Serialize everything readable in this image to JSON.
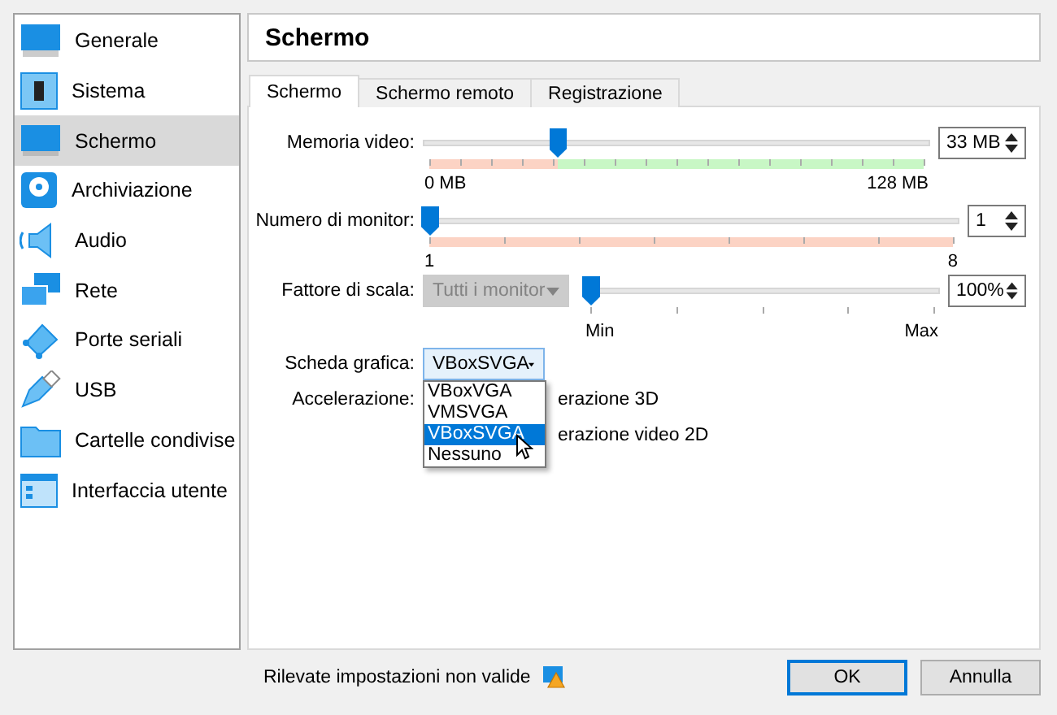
{
  "sidebar": {
    "items": [
      {
        "label": "Generale",
        "selected": false
      },
      {
        "label": "Sistema",
        "selected": false
      },
      {
        "label": "Schermo",
        "selected": true
      },
      {
        "label": "Archiviazione",
        "selected": false
      },
      {
        "label": "Audio",
        "selected": false
      },
      {
        "label": "Rete",
        "selected": false
      },
      {
        "label": "Porte seriali",
        "selected": false
      },
      {
        "label": "USB",
        "selected": false
      },
      {
        "label": "Cartelle condivise",
        "selected": false
      },
      {
        "label": "Interfaccia utente",
        "selected": false
      }
    ]
  },
  "page_title": "Schermo",
  "tabs": [
    {
      "label": "Schermo",
      "selected": true
    },
    {
      "label": "Schermo remoto",
      "selected": false
    },
    {
      "label": "Registrazione",
      "selected": false
    }
  ],
  "memory": {
    "label": "Memoria video:",
    "level": 0.26,
    "value": "33 MB",
    "warn_zone": true,
    "ok_zone": true,
    "min_label": "0 MB",
    "max_label": "128 MB"
  },
  "monitors": {
    "label": "Numero di monitor:",
    "level": 0,
    "value": "1",
    "warn_zone": true,
    "ok_zone": false,
    "min_label": "1",
    "max_label": "8"
  },
  "scale_factor": {
    "label": "Fattore di scala:",
    "combo": {
      "value": "Tutti i monitor",
      "disabled": true
    },
    "level": 0,
    "value": "100%",
    "warn_zone": false,
    "ok_zone": false,
    "min_label": "Min",
    "max_label": "Max"
  },
  "graphics": {
    "label": "Scheda grafica:",
    "value": "VBoxSVGA",
    "expanded": true,
    "options": [
      {
        "label": "VBoxVGA",
        "selected": false
      },
      {
        "label": "VMSVGA",
        "selected": false
      },
      {
        "label": "VBoxSVGA",
        "selected": true
      },
      {
        "label": "Nessuno",
        "selected": false
      }
    ]
  },
  "acceleration": {
    "label": "Accelerazione:",
    "options": [
      "erazione 3D",
      "erazione video 2D"
    ]
  },
  "status": "Rilevate impostazioni non valide",
  "buttons": [
    {
      "label": "OK",
      "default": true
    },
    {
      "label": "Annulla",
      "default": false
    }
  ]
}
